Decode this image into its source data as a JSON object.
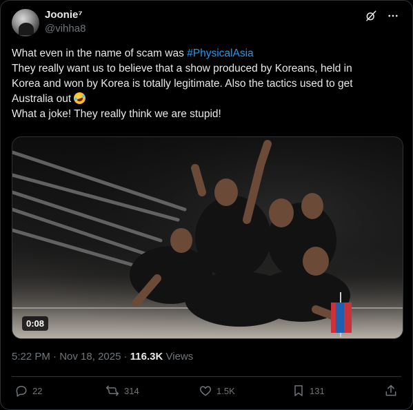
{
  "author": {
    "name": "Joonie⁷",
    "handle": "@vihha8"
  },
  "post": {
    "lines": [
      {
        "text": "What even in the name of scam was ",
        "hashtag": "#PhysicalAsia"
      },
      {
        "text": "They really want us to believe that a show produced by Koreans, held in"
      },
      {
        "text": "Korea and won by Korea is totally legitimate. Also the tactics used to get"
      },
      {
        "text": "Australia out",
        "emoji": "rolling-on-the-floor-laughing-emoji"
      },
      {
        "text": "What a joke! They really think we are stupid!"
      }
    ]
  },
  "media": {
    "duration": "0:08"
  },
  "meta": {
    "time": "5:22 PM",
    "separator": " · ",
    "date": "Nov 18, 2025",
    "views_count": "116.3K",
    "views_label": " Views"
  },
  "actions": {
    "replies": "22",
    "reposts": "314",
    "likes": "1.5K",
    "bookmarks": "131"
  },
  "icons": {
    "grok": "grok-icon",
    "more": "more-icon",
    "reply": "reply-icon",
    "repost": "repost-icon",
    "like": "like-icon",
    "bookmark": "bookmark-icon",
    "share": "share-icon"
  },
  "colors": {
    "background": "#000000",
    "text": "#e7e9ea",
    "muted": "#71767b",
    "link": "#1d9bf0",
    "border": "#2f3336"
  }
}
